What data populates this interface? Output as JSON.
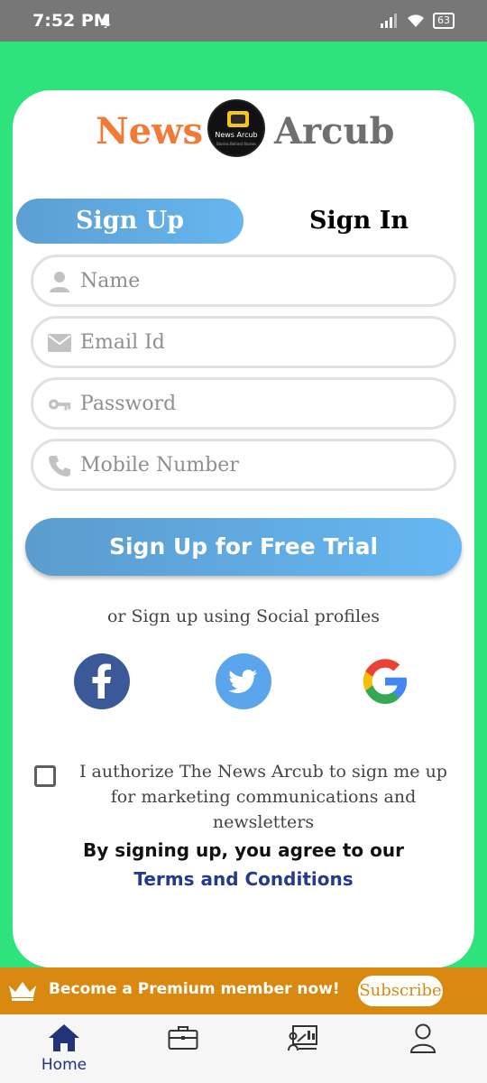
{
  "status_bar": {
    "time": "7:52 PM",
    "battery": "63"
  },
  "brand": {
    "word1": "News",
    "word2": "Arcub",
    "logo_caption": "News Arcub",
    "logo_subcaption": "Stories Behind Stories"
  },
  "tabs": {
    "signup": "Sign Up",
    "signin": "Sign In"
  },
  "form": {
    "name_placeholder": "Name",
    "email_placeholder": "Email Id",
    "password_placeholder": "Password",
    "mobile_placeholder": "Mobile Number"
  },
  "cta_label": "Sign Up for Free Trial",
  "social": {
    "prompt": "or Sign up using Social profiles",
    "icons": [
      "facebook-icon",
      "twitter-icon",
      "google-icon"
    ]
  },
  "consent": {
    "text": "I authorize The News Arcub to sign me up for marketing communications and newsletters",
    "checked": false
  },
  "agreement": {
    "text": "By signing up, you agree to our",
    "link": "Terms and Conditions"
  },
  "premium": {
    "text": "Become a Premium member now!",
    "button": "Subscribe"
  },
  "bottom_nav": {
    "home_label": "Home",
    "items": [
      "home-icon",
      "briefcase-icon",
      "presentation-icon",
      "profile-icon"
    ]
  },
  "colors": {
    "background": "#2fe37c",
    "accent_blue": "#5fa9e3",
    "brand_orange": "#f27a35",
    "premium": "#d9890f",
    "link": "#253a8c"
  }
}
